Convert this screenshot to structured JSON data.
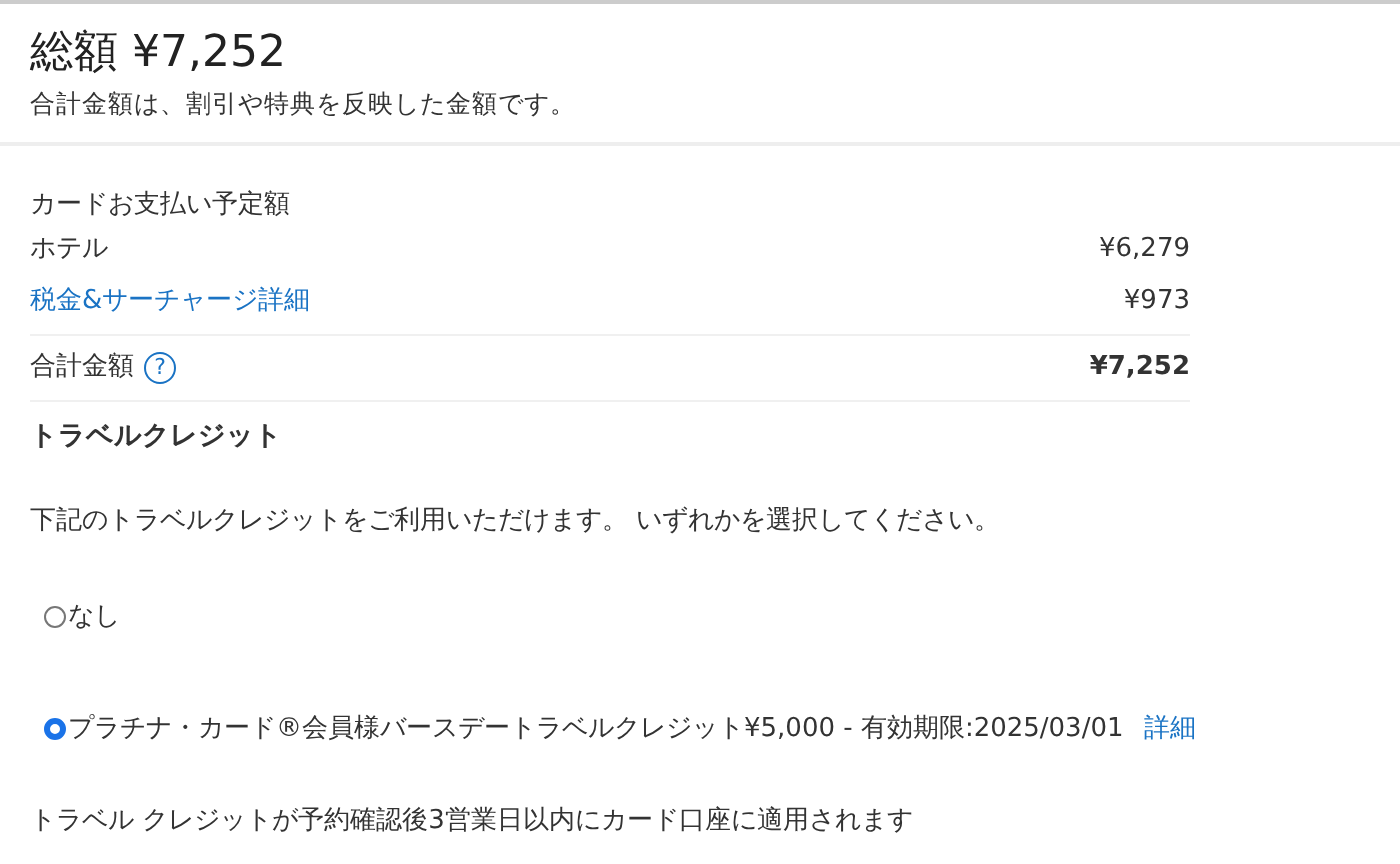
{
  "summary": {
    "title": "総額 ¥7,252",
    "note": "合計金額は、割引や特典を反映した金額です。"
  },
  "breakdown": {
    "heading": "カードお支払い予定額",
    "rows": [
      {
        "kind": "text",
        "label": "ホテル",
        "amount": "¥6,279"
      },
      {
        "kind": "link",
        "label": "税金&サーチャージ詳細",
        "amount": "¥973"
      },
      {
        "kind": "total",
        "label": "合計金額",
        "help": "?",
        "amount": "¥7,252"
      }
    ]
  },
  "travel_credit": {
    "title": "トラベルクレジット",
    "description": "下記のトラベルクレジットをご利用いただけます。 いずれかを選択してください。",
    "options": [
      {
        "label": "なし",
        "selected": false
      },
      {
        "label": "プラチナ・カード®会員様バースデートラベルクレジット¥5,000 - 有効期限:2025/03/01",
        "link": "詳細",
        "selected": true
      }
    ],
    "footer": "トラベル クレジットが予約確認後3営業日以内にカード口座に適用されます"
  }
}
